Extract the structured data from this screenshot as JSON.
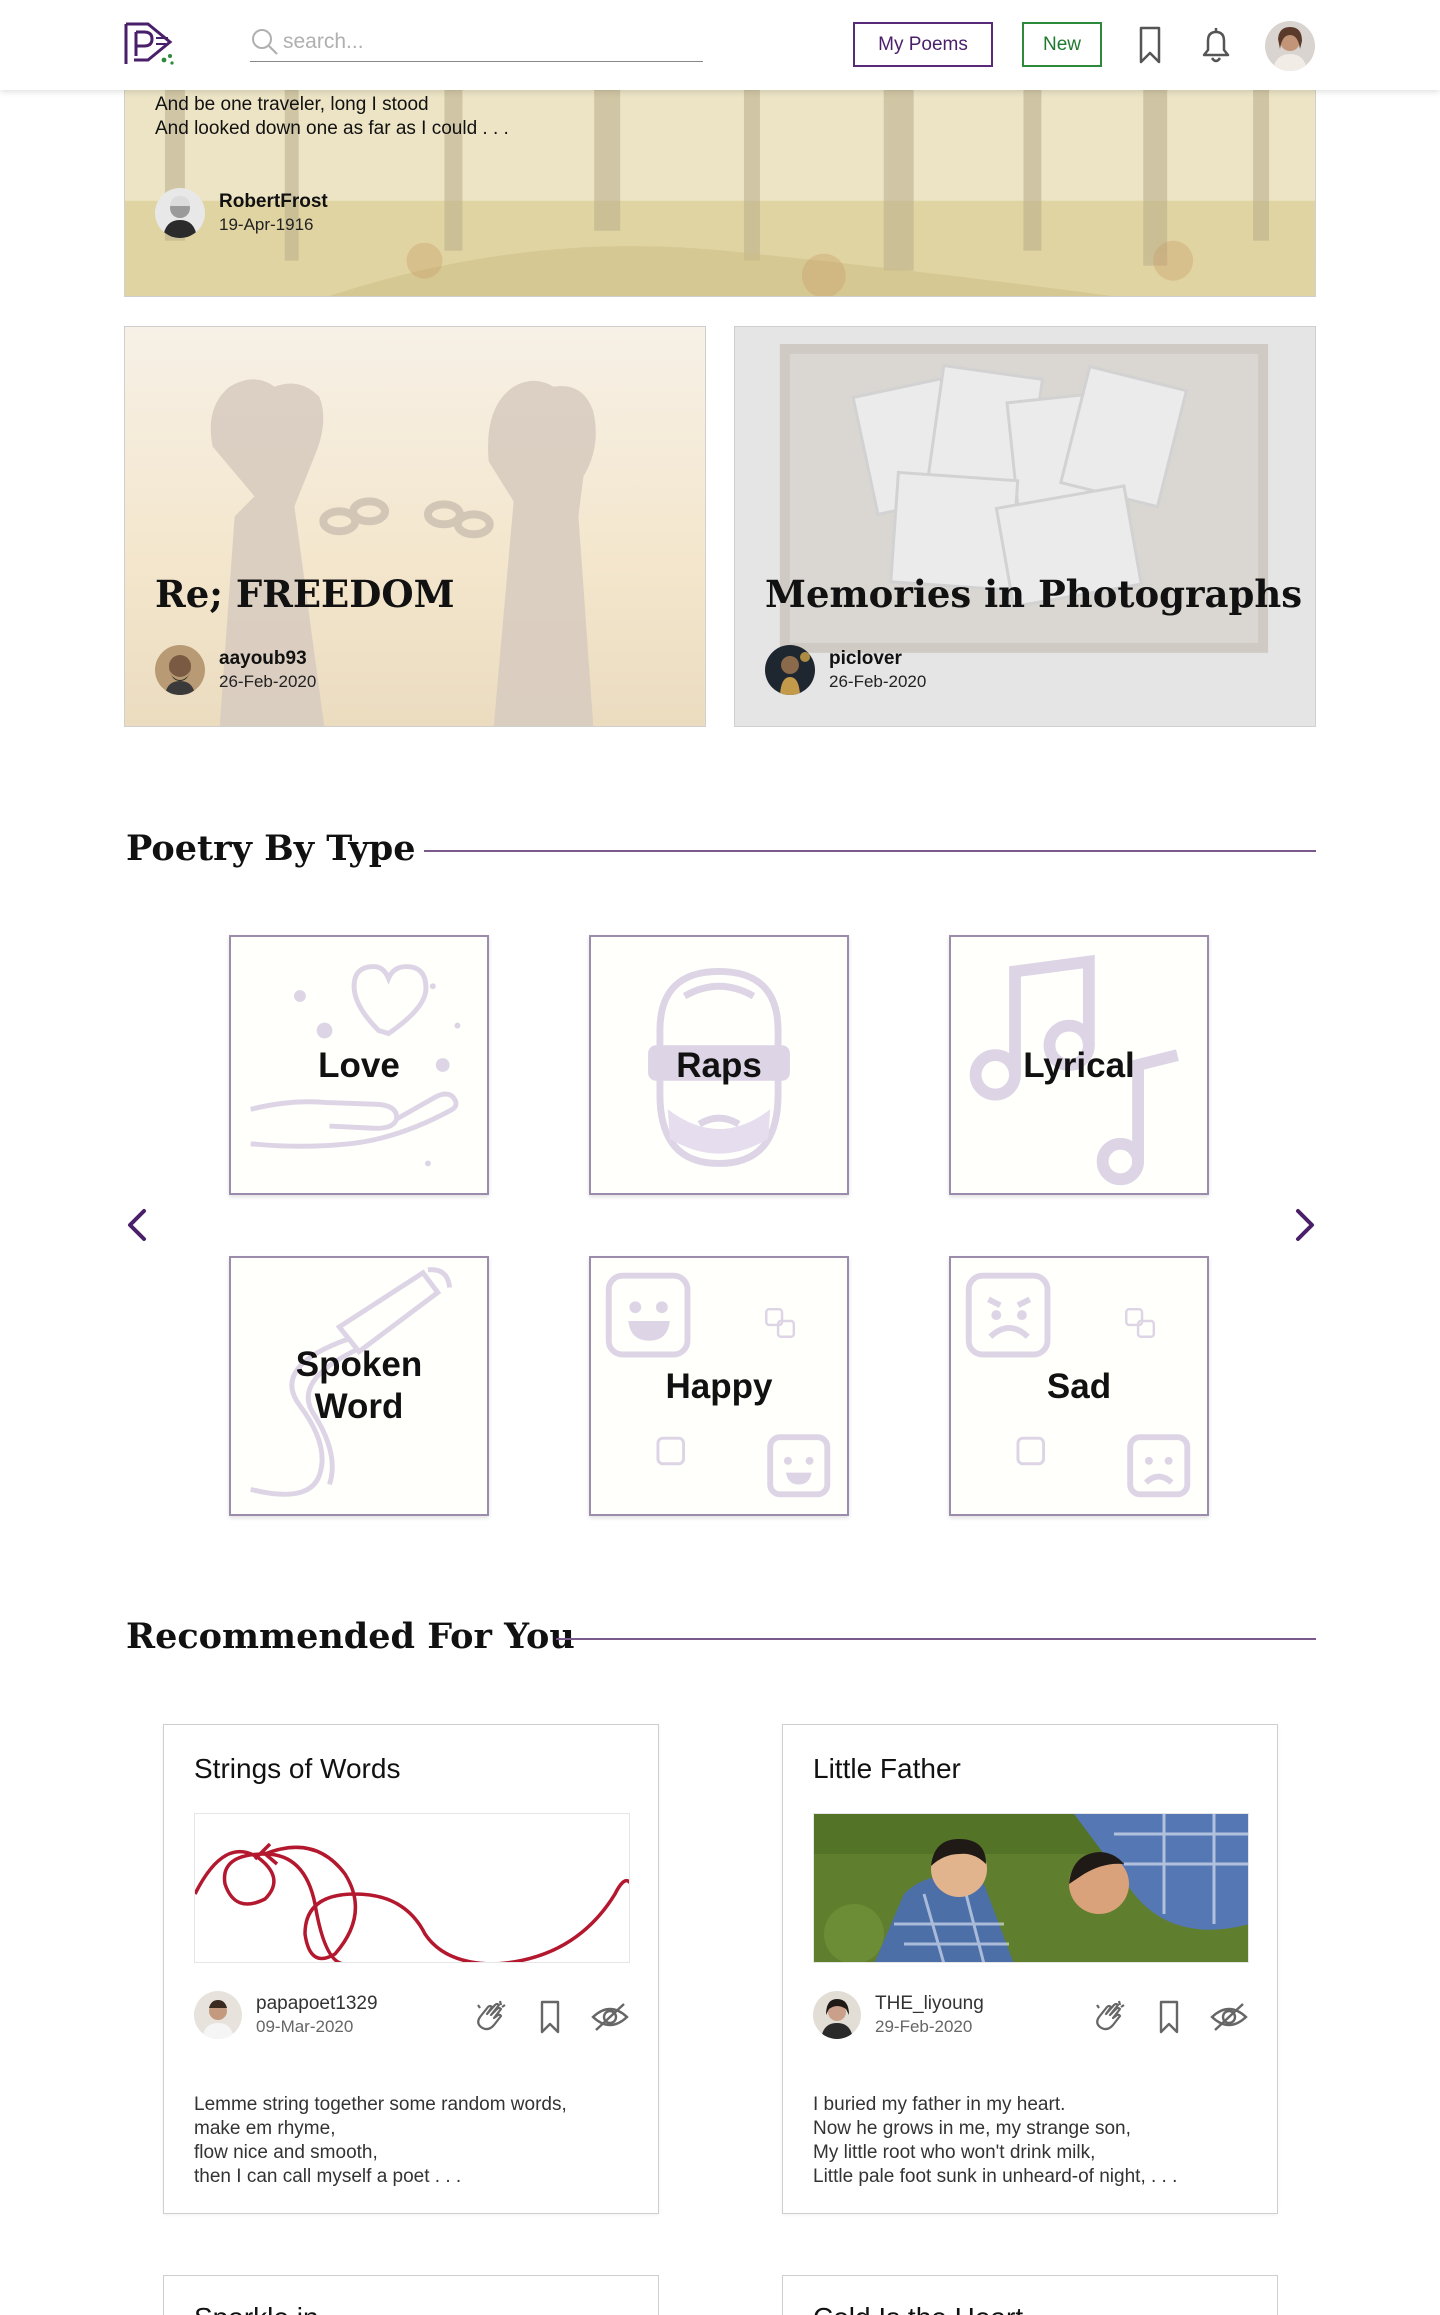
{
  "header": {
    "search_placeholder": "search...",
    "my_poems_label": "My Poems",
    "new_label": "New",
    "colors": {
      "primary": "#4a1f6a",
      "new_green": "#1f7a2e"
    }
  },
  "hero": {
    "lines": [
      "And be one traveler, long I stood",
      "And looked down one as far as I could . . ."
    ],
    "author": "RobertFrost",
    "date": "19-Apr-1916"
  },
  "features": [
    {
      "title": "Re; FREEDOM",
      "author": "aayoub93",
      "date": "26-Feb-2020"
    },
    {
      "title": "Memories in Photographs",
      "author": "piclover",
      "date": "26-Feb-2020"
    }
  ],
  "poetry_by_type": {
    "title": "Poetry By Type",
    "types": [
      "Love",
      "Raps",
      "Lyrical",
      "Spoken Word",
      "Happy",
      "Sad"
    ]
  },
  "recommended": {
    "title": "Recommended For You",
    "cards": [
      {
        "title": "Strings of Words",
        "author": "papapoet1329",
        "date": "09-Mar-2020",
        "lines": [
          "Lemme string together some random words,",
          "make em rhyme,",
          "flow nice and smooth,",
          "then I can call myself a poet . . ."
        ]
      },
      {
        "title": "Little Father",
        "author": "THE_liyoung",
        "date": "29-Feb-2020",
        "lines": [
          "I buried my father in my heart.",
          "Now he grows in me, my strange son,",
          "My little root who won't drink milk,",
          "Little pale foot sunk in unheard-of night, . . ."
        ]
      }
    ],
    "more_cards": [
      "Sparkle in...",
      "Cold Is the Heart"
    ]
  }
}
